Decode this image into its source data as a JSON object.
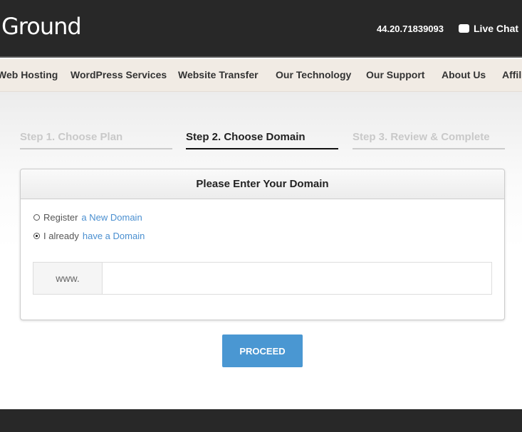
{
  "header": {
    "logo": "Ground",
    "phone": "44.20.71839093",
    "live_chat": "Live Chat"
  },
  "nav": [
    "Web Hosting",
    "WordPress Services",
    "Website Transfer",
    "Our Technology",
    "Our Support",
    "About Us",
    "Affiliates"
  ],
  "steps": [
    {
      "label": "Step 1. Choose Plan",
      "active": false
    },
    {
      "label": "Step 2. Choose Domain",
      "active": true
    },
    {
      "label": "Step 3. Review & Complete",
      "active": false
    }
  ],
  "panel": {
    "title": "Please Enter Your Domain",
    "options": [
      {
        "prefix": "Register",
        "link": "a New Domain",
        "selected": false
      },
      {
        "prefix": "I already",
        "link": "have a Domain",
        "selected": true
      }
    ],
    "domain_prefix": "www.",
    "domain_value": ""
  },
  "proceed": "PROCEED"
}
